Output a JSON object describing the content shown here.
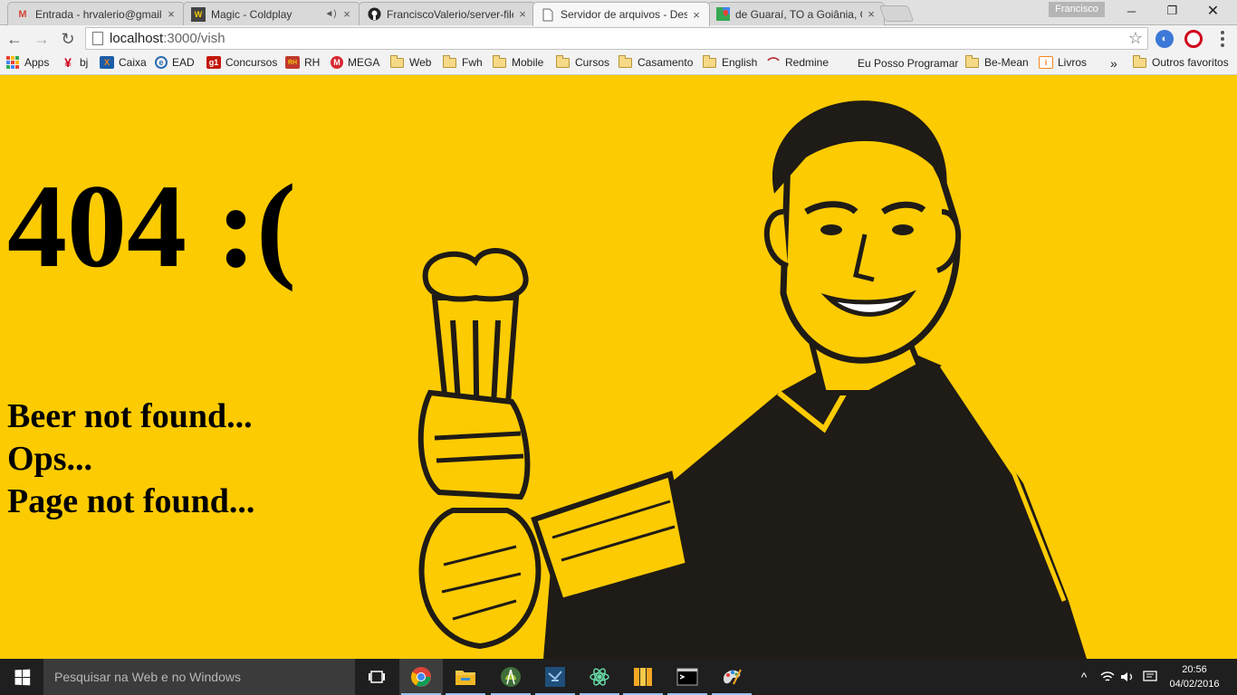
{
  "browser": {
    "tabs": [
      {
        "label": "Entrada - hrvalerio@gmail",
        "icon": "gmail-icon",
        "color": "#d44638"
      },
      {
        "label": "Magic - Coldplay",
        "icon": "audio-site-icon",
        "color": "#444444"
      },
      {
        "label": "FranciscoValerio/server-file",
        "icon": "github-icon",
        "color": "#222222"
      },
      {
        "label": "Servidor de arquivos - Des",
        "icon": "page-icon",
        "color": "#777777"
      },
      {
        "label": "de Guaraí, TO a Goiânia, G",
        "icon": "google-maps-icon",
        "color": "#34a853"
      }
    ],
    "active_tab": 3,
    "profile_name": "Francisco",
    "url_host": "localhost",
    "url_path": ":3000/vish",
    "bookmarks": [
      {
        "label": "Apps",
        "icon": "apps-icon"
      },
      {
        "label": "bj",
        "icon": "bj-icon"
      },
      {
        "label": "Caixa",
        "icon": "caixa-icon"
      },
      {
        "label": "EAD",
        "icon": "ead-icon"
      },
      {
        "label": "Concursos",
        "icon": "g1-icon"
      },
      {
        "label": "RH",
        "icon": "rh-icon"
      },
      {
        "label": "MEGA",
        "icon": "mega-icon"
      },
      {
        "label": "Web",
        "icon": "folder-icon"
      },
      {
        "label": "Fwh",
        "icon": "folder-icon"
      },
      {
        "label": "Mobile",
        "icon": "folder-icon"
      },
      {
        "label": "Cursos",
        "icon": "folder-icon"
      },
      {
        "label": "Casamento",
        "icon": "folder-icon"
      },
      {
        "label": "English",
        "icon": "folder-icon"
      },
      {
        "label": "Redmine",
        "icon": "redmine-icon"
      },
      {
        "label": "Eu Posso Programar",
        "icon": "microsoft-icon"
      },
      {
        "label": "Be-Mean",
        "icon": "folder-icon"
      },
      {
        "label": "Livros",
        "icon": "livros-icon"
      }
    ],
    "overflow_label": "»",
    "other_bookmarks": "Outros favoritos"
  },
  "page": {
    "heading": "404 :(",
    "lines": [
      "Beer not found...",
      "Ops...",
      "Page not found..."
    ],
    "background": "#fdcb02",
    "illustration": "man-raising-beer-glass"
  },
  "taskbar": {
    "search_placeholder": "Pesquisar na Web e no Windows",
    "apps": [
      "task-view-icon",
      "chrome-icon",
      "file-explorer-icon",
      "android-studio-icon",
      "visual-studio-code-icon",
      "atom-icon",
      "sublime-icon",
      "terminal-icon",
      "paint-icon"
    ],
    "time": "20:56",
    "date": "04/02/2016"
  }
}
